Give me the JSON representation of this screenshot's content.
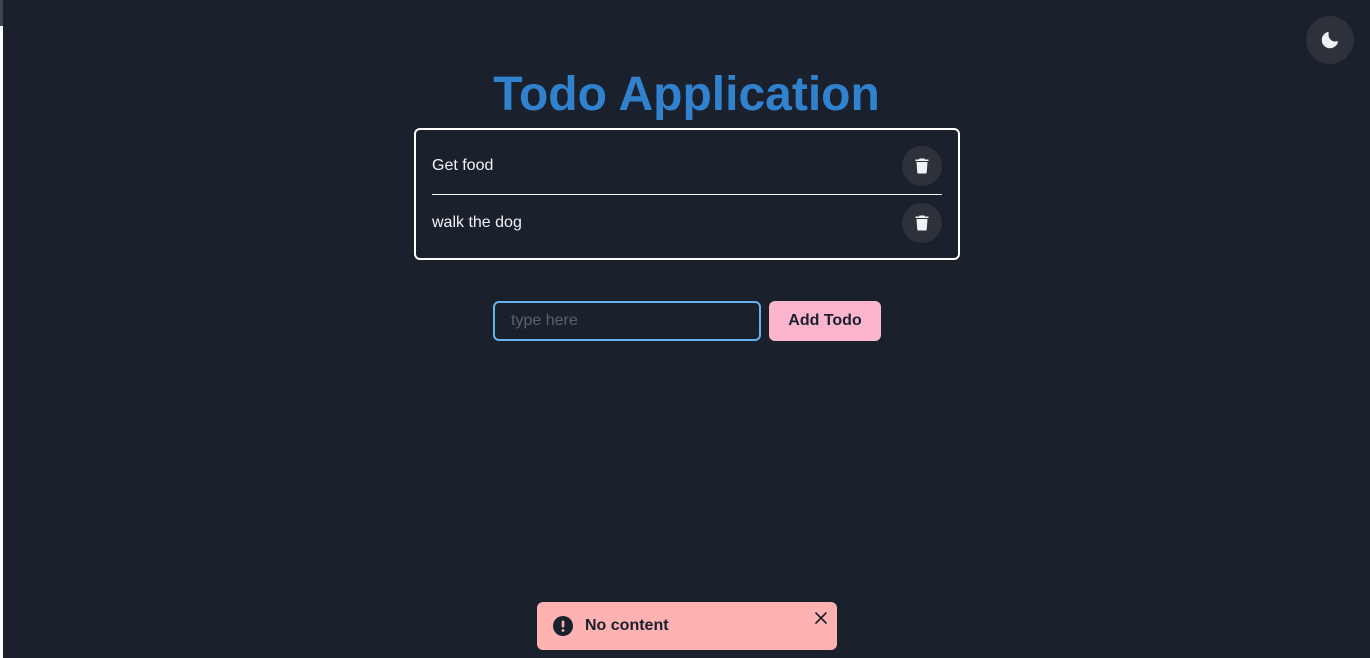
{
  "header": {
    "title": "Todo Application",
    "theme_toggle_icon": "moon-icon"
  },
  "todos": [
    {
      "text": "Get food",
      "delete_icon": "trash-icon"
    },
    {
      "text": "walk the dog",
      "delete_icon": "trash-icon"
    }
  ],
  "form": {
    "input_value": "",
    "input_placeholder": "type here",
    "add_label": "Add Todo"
  },
  "toast": {
    "status": "error",
    "icon": "alert-circle-icon",
    "message": "No content",
    "close_icon": "close-icon"
  },
  "colors": {
    "background": "#1a202c",
    "title": "#3182ce",
    "input_border": "#63b3ed",
    "add_button": "#fbb6ce",
    "toast": "#feb2b2"
  }
}
